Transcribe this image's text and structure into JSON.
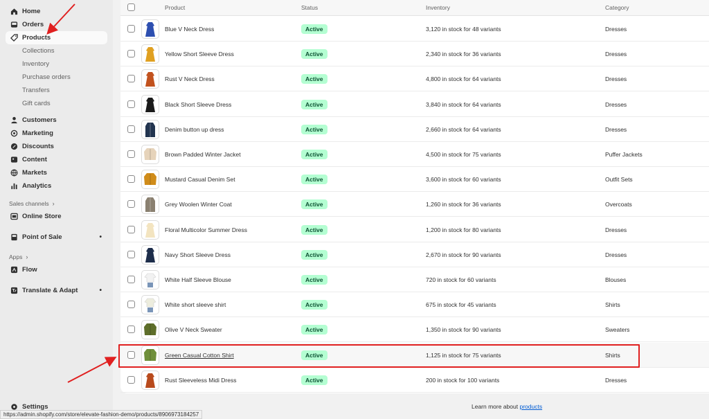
{
  "sidebar": {
    "home": "Home",
    "orders": "Orders",
    "products": "Products",
    "products_sub": [
      "Collections",
      "Inventory",
      "Purchase orders",
      "Transfers",
      "Gift cards"
    ],
    "customers": "Customers",
    "marketing": "Marketing",
    "discounts": "Discounts",
    "content": "Content",
    "markets": "Markets",
    "analytics": "Analytics",
    "sales_channels": "Sales channels",
    "online_store": "Online Store",
    "point_of_sale": "Point of Sale",
    "apps": "Apps",
    "flow": "Flow",
    "translate": "Translate & Adapt",
    "settings": "Settings"
  },
  "table": {
    "headers": {
      "product": "Product",
      "status": "Status",
      "inventory": "Inventory",
      "category": "Category"
    },
    "rows": [
      {
        "name": "Blue V Neck Dress",
        "status": "Active",
        "inventory": "3,120 in stock for 48 variants",
        "category": "Dresses",
        "color": "#2d4fb0",
        "shape": "dress"
      },
      {
        "name": "Yellow Short Sleeve Dress",
        "status": "Active",
        "inventory": "2,340 in stock for 36 variants",
        "category": "Dresses",
        "color": "#e0a020",
        "shape": "dress"
      },
      {
        "name": "Rust V Neck Dress",
        "status": "Active",
        "inventory": "4,800 in stock for 64 variants",
        "category": "Dresses",
        "color": "#c2521e",
        "shape": "dress"
      },
      {
        "name": "Black Short Sleeve Dress",
        "status": "Active",
        "inventory": "3,840 in stock for 64 variants",
        "category": "Dresses",
        "color": "#1a1a1a",
        "shape": "dress"
      },
      {
        "name": "Denim button up dress",
        "status": "Active",
        "inventory": "2,660 in stock for 64 variants",
        "category": "Dresses",
        "color": "#22344f",
        "shape": "coat"
      },
      {
        "name": "Brown Padded Winter Jacket",
        "status": "Active",
        "inventory": "4,500 in stock for 75 variants",
        "category": "Puffer Jackets",
        "color": "#e6d3ba",
        "shape": "jacket"
      },
      {
        "name": "Mustard Casual Denim Set",
        "status": "Active",
        "inventory": "3,600 in stock for 60 variants",
        "category": "Outfit Sets",
        "color": "#d08c1a",
        "shape": "jacket"
      },
      {
        "name": "Grey Woolen Winter Coat",
        "status": "Active",
        "inventory": "1,260 in stock for 36 variants",
        "category": "Overcoats",
        "color": "#8a8070",
        "shape": "coat"
      },
      {
        "name": "Floral Multicolor Summer Dress",
        "status": "Active",
        "inventory": "1,200 in stock for 80 variants",
        "category": "Dresses",
        "color": "#f3e4c0",
        "shape": "dress"
      },
      {
        "name": "Navy Short Sleeve Dress",
        "status": "Active",
        "inventory": "2,670 in stock for 90 variants",
        "category": "Dresses",
        "color": "#1d2d4a",
        "shape": "dress"
      },
      {
        "name": "White Half Sleeve Blouse",
        "status": "Active",
        "inventory": "720 in stock for 60 variants",
        "category": "Blouses",
        "color": "#f2f2f2",
        "shape": "blouse"
      },
      {
        "name": "White short sleeve shirt",
        "status": "Active",
        "inventory": "675 in stock for 45 variants",
        "category": "Shirts",
        "color": "#ededde",
        "shape": "blouse"
      },
      {
        "name": "Olive V Neck Sweater",
        "status": "Active",
        "inventory": "1,350 in stock for 90 variants",
        "category": "Sweaters",
        "color": "#5e6e2a",
        "shape": "jacket"
      },
      {
        "name": "Green Casual Cotton Shirt",
        "status": "Active",
        "inventory": "1,125 in stock for 75 variants",
        "category": "Shirts",
        "color": "#6f8f3a",
        "shape": "jacket"
      },
      {
        "name": "Rust Sleeveless Midi Dress",
        "status": "Active",
        "inventory": "200 in stock for 100 variants",
        "category": "Dresses",
        "color": "#b84a1c",
        "shape": "dress"
      }
    ]
  },
  "footer": {
    "learn_prefix": "Learn more about ",
    "learn_link": "products"
  },
  "status_url": "https://admin.shopify.com/store/elevate-fashion-demo/products/8906973184257",
  "annotation_color": "#e02020"
}
